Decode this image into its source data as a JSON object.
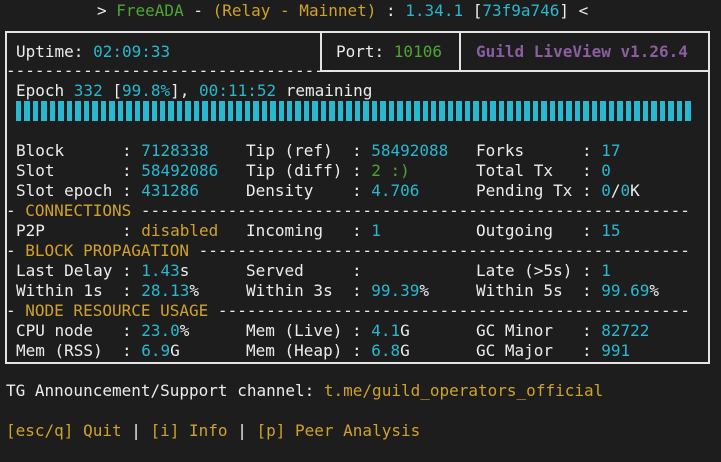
{
  "header": {
    "prefix": "> ",
    "app": "FreeADA",
    "sep1": " - ",
    "mode": "(Relay - Mainnet)",
    "sep2": " : ",
    "version": "1.34.1",
    "sep3": " [",
    "commit": "73f9a746",
    "suffix": "] <"
  },
  "top": {
    "uptime_label": "Uptime: ",
    "uptime_value": "02:09:33",
    "port_label": "Port: ",
    "port_value": "10106",
    "liveview": "Guild LiveView v1.26.4",
    "divider": "----------------------------------"
  },
  "epoch": {
    "label": "Epoch ",
    "number": "332",
    "open": " [",
    "percent": "99.8%",
    "close": "], ",
    "remaining_time": "00:11:52",
    "remaining_label": " remaining",
    "progress": 0.998
  },
  "stats": {
    "block_label": "Block      : ",
    "block_value": "7128338",
    "tipref_label": "Tip (ref)  : ",
    "tipref_value": "58492088",
    "forks_label": "Forks      : ",
    "forks_value": "17",
    "slot_label": "Slot       : ",
    "slot_value": "58492086",
    "tipdiff_label": "Tip (diff) : ",
    "tipdiff_value": "2 :)",
    "totaltx_label": "Total Tx   : ",
    "totaltx_value": "0",
    "slotepoch_label": "Slot epoch : ",
    "slotepoch_value": "431286",
    "density_label": "Density    : ",
    "density_value": "4.706",
    "pending_label": "Pending Tx : ",
    "pending_value1": "0",
    "pending_slash": "/",
    "pending_value2": "0",
    "pending_unit": "K"
  },
  "connections": {
    "lead": "- ",
    "title": "CONNECTIONS",
    "trail": " ---------------------------------------------------------",
    "p2p_label": "P2P        : ",
    "p2p_value": "disabled",
    "incoming_label": "Incoming   : ",
    "incoming_value": "1",
    "outgoing_label": "Outgoing   : ",
    "outgoing_value": "15"
  },
  "propagation": {
    "lead": "- ",
    "title": "BLOCK PROPAGATION",
    "trail": " ---------------------------------------------------",
    "lastdelay_label": "Last Delay : ",
    "lastdelay_value": "1.43",
    "lastdelay_unit": "s",
    "served_label": "Served     : ",
    "late_label": "Late (>5s) : ",
    "late_value": "1",
    "within1_label": "Within 1s  : ",
    "within1_value": "28.13",
    "within3_label": "Within 3s  : ",
    "within3_value": "99.39",
    "within5_label": "Within 5s  : ",
    "within5_value": "99.69",
    "pct": "%"
  },
  "resources": {
    "lead": "- ",
    "title": "NODE RESOURCE USAGE",
    "trail": " -------------------------------------------------",
    "cpu_label": "CPU node   : ",
    "cpu_value": "23.0",
    "cpu_unit": "%",
    "memlive_label": "Mem (Live) : ",
    "memlive_value": "4.1",
    "memlive_unit": "G",
    "gcminor_label": "GC Minor   : ",
    "gcminor_value": "82722",
    "memrss_label": "Mem (RSS)  : ",
    "memrss_value": "6.9",
    "memrss_unit": "G",
    "memheap_label": "Mem (Heap) : ",
    "memheap_value": "6.8",
    "memheap_unit": "G",
    "gcmajor_label": "GC Major   : ",
    "gcmajor_value": "991"
  },
  "footer": {
    "tg_label": "TG Announcement/Support channel: ",
    "tg_link": "t.me/guild_operators_official",
    "quit": "[esc/q] Quit",
    "sep": " | ",
    "info": "[i] Info",
    "peer": "[p] Peer Analysis"
  },
  "colors": {
    "background": "#1d1d1d",
    "text": "#ececec",
    "cyan": "#29b8cf",
    "green": "#4ea534",
    "yellow": "#d0a22b",
    "purple": "#8a5ea0"
  }
}
